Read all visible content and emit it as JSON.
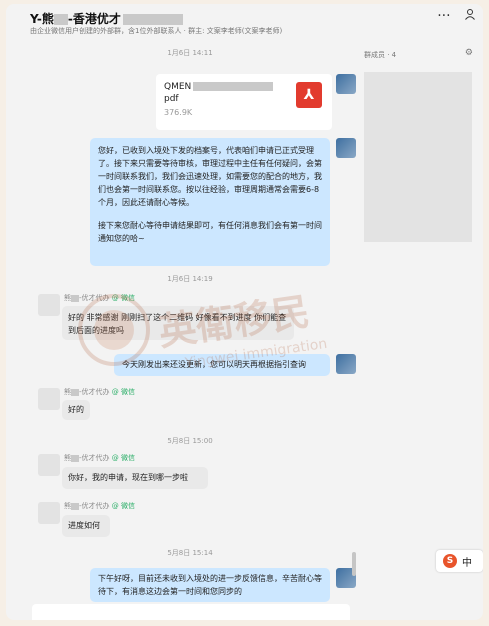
{
  "header": {
    "title_prefix": "Y-熊",
    "title_mid": "-香港优才",
    "subtitle": "由企业微信用户创建的外部群，含1位外部联系人 · 群主: 文案李老师(文案李老师)",
    "more_icon": "···",
    "person_icon": "person-icon"
  },
  "messages": {
    "ts1": "1月6日 14:11",
    "file": {
      "name": "QMEN",
      "ext": "pdf",
      "size": "376.9K"
    },
    "msg1": "您好，已收到入境处下发的档案号，代表咱们申请已正式受理了。接下来只需要等待审核，审理过程中主任有任何疑问，会第一时间联系我们，我们会迅速处理，如需要您的配合的地方，我们也会第一时间联系您。按以往经验，审理周期通常会需要6-8个月，因此还请耐心等候。",
    "msg1b": "接下来您耐心等待申请结果即可，有任何消息我们会有第一时间通知您的哈~",
    "ts2": "1月6日 14:19",
    "sender_name": "熊",
    "sender_suffix": "-优才代办",
    "wechat": "@ 微信",
    "msg2": "好的 非常感谢 刚刚扫了这个二维码 好像看不到进度 你们能查到后面的进度吗",
    "msg3": "今天刚发出来还没更新，您可以明天再根据指引查询",
    "msg4": "好的",
    "ts3": "5月8日 15:00",
    "msg5": "你好，我的申请，现在到哪一步啦",
    "msg6": "进度如何",
    "ts4": "5月8日 15:14",
    "msg7": "下午好呀，目前还未收到入境处的进一步反馈信息，辛苦耐心等待下，有消息这边会第一时间和您同步的"
  },
  "watermark": {
    "cn": "英衛移民",
    "en": "Yingwei immigration"
  },
  "right_panel": {
    "members": "群成员 · 4",
    "settings_icon": "gear-icon"
  },
  "widget": {
    "s": "S",
    "t": "中"
  }
}
